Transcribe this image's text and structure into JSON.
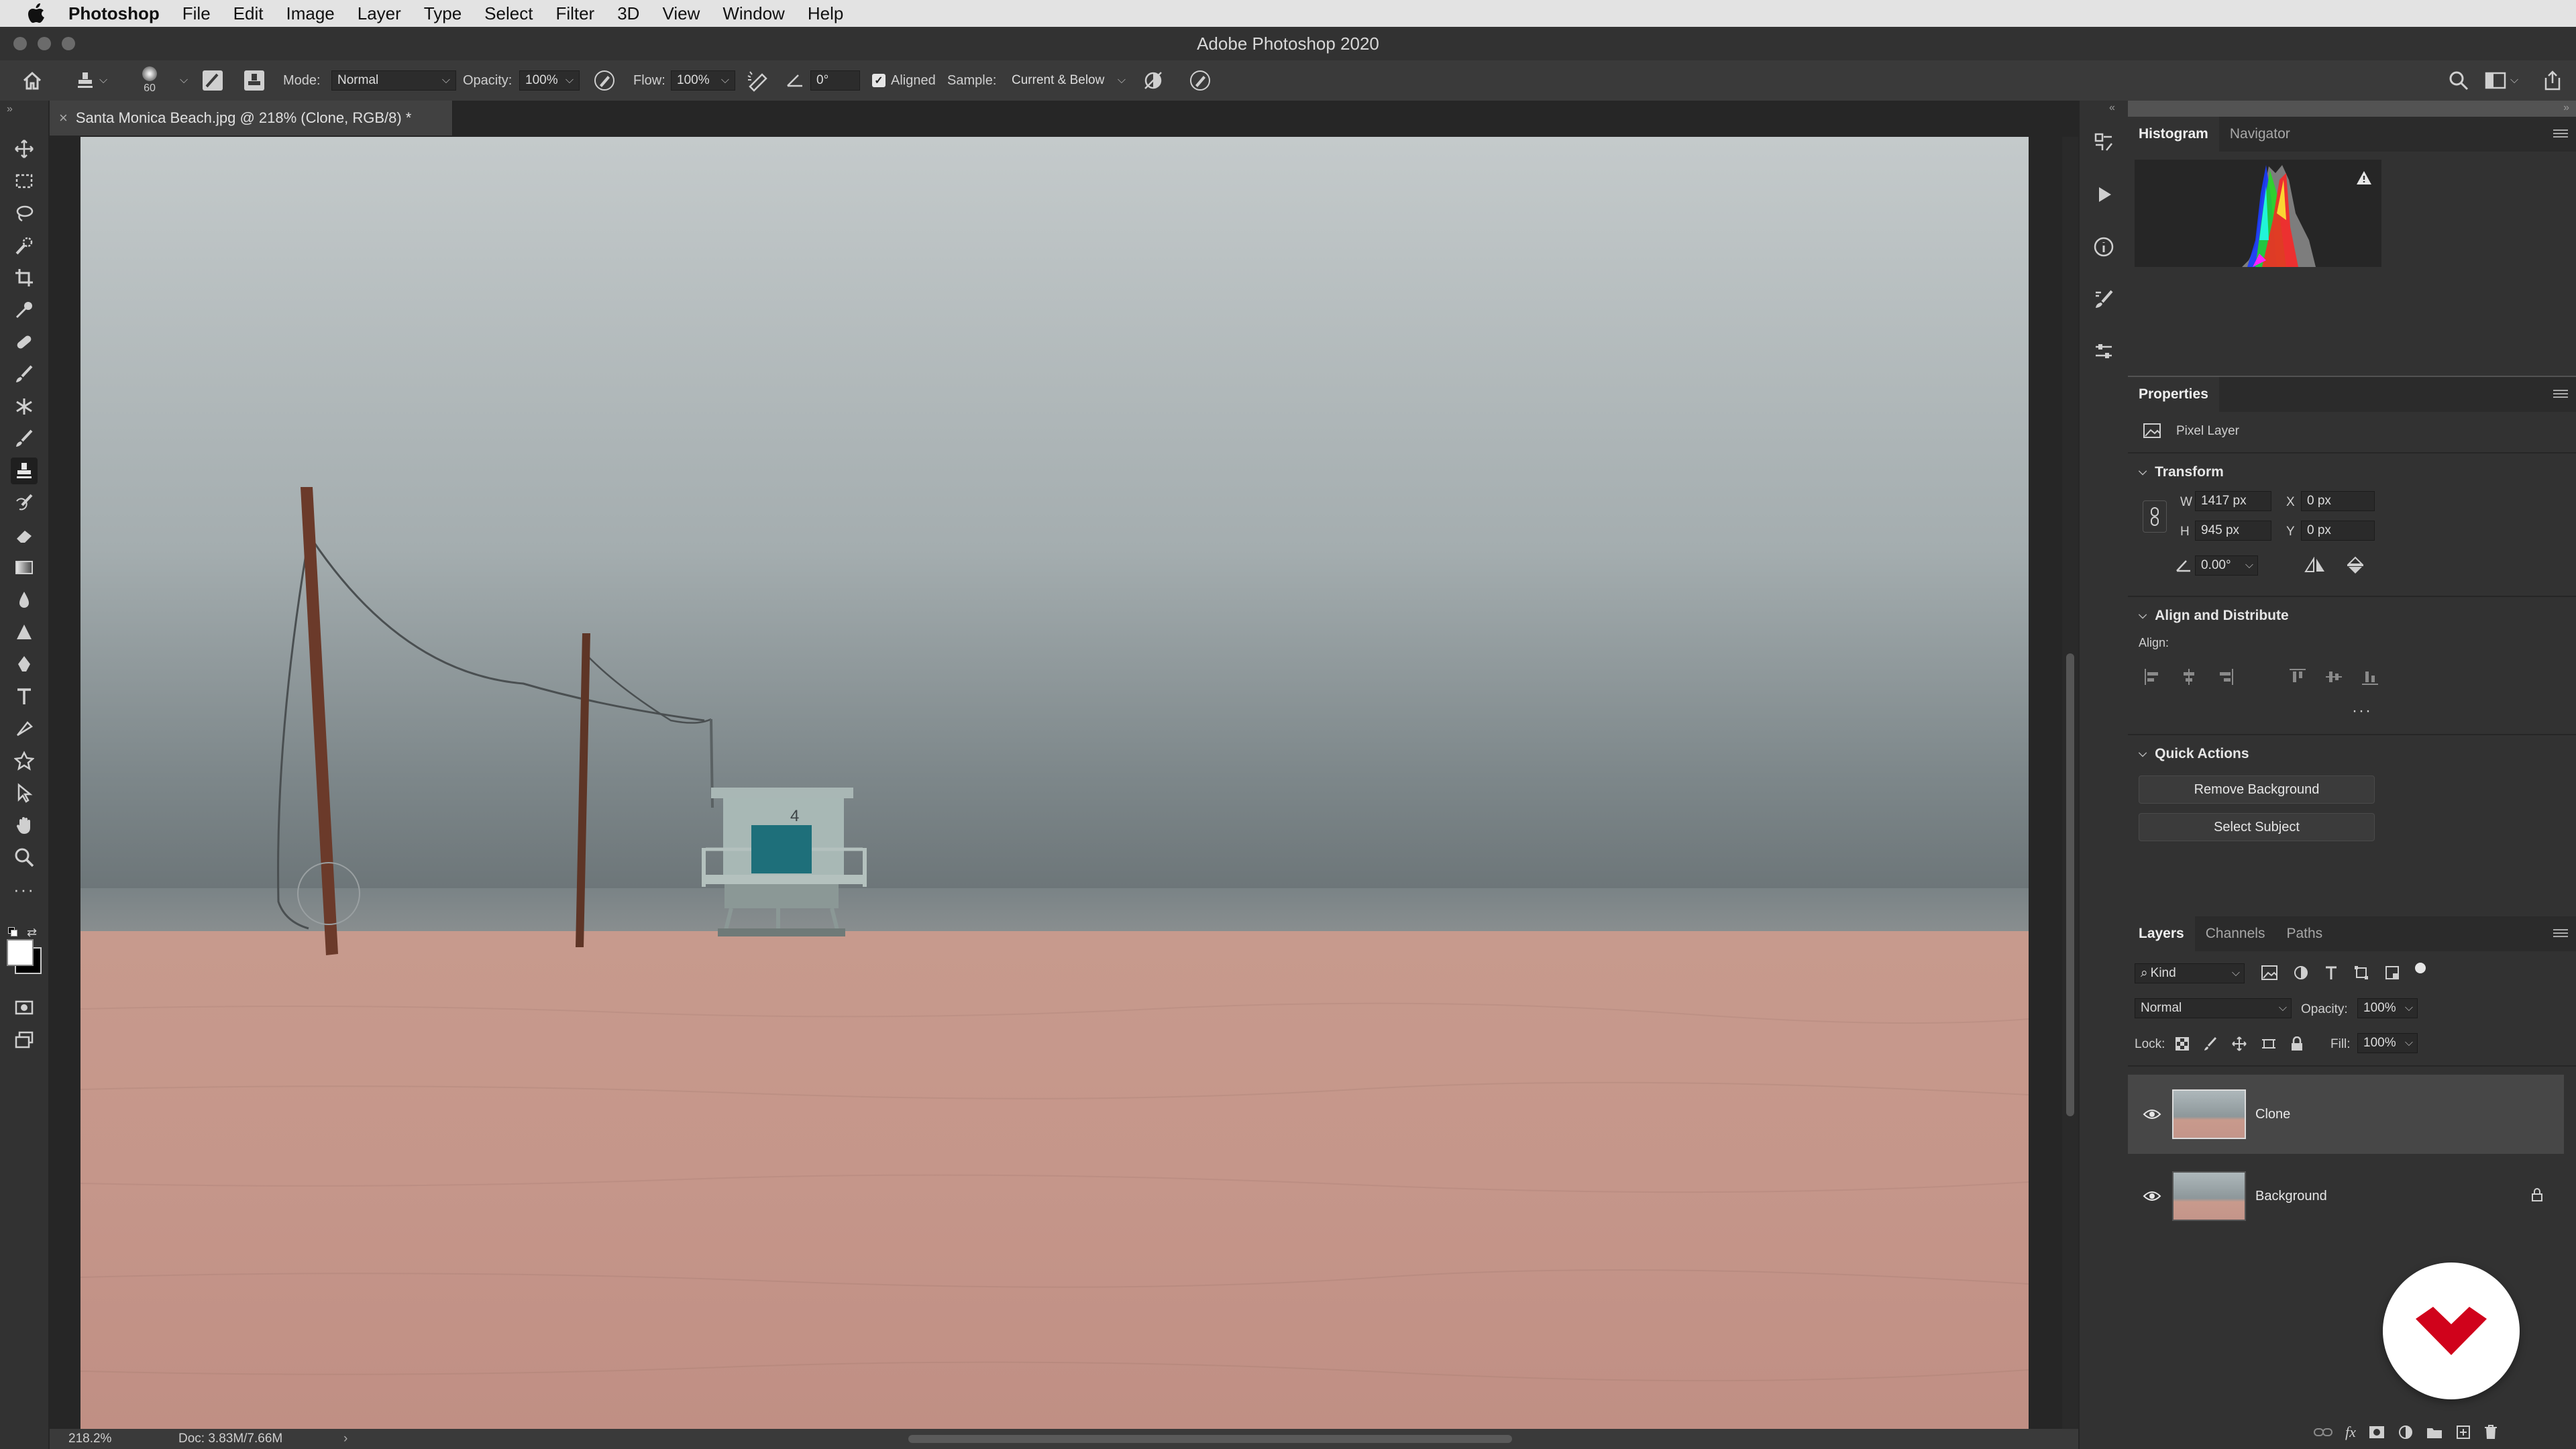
{
  "menubar": {
    "app_name": "Photoshop",
    "items": [
      "File",
      "Edit",
      "Image",
      "Layer",
      "Type",
      "Select",
      "Filter",
      "3D",
      "View",
      "Window",
      "Help"
    ]
  },
  "window": {
    "title": "Adobe Photoshop 2020"
  },
  "options_bar": {
    "brush_size": "60",
    "mode_label": "Mode:",
    "mode_value": "Normal",
    "opacity_label": "Opacity:",
    "opacity_value": "100%",
    "flow_label": "Flow:",
    "flow_value": "100%",
    "angle_value": "0°",
    "aligned_label": "Aligned",
    "aligned_checked": true,
    "sample_label": "Sample:",
    "sample_value": "Current & Below"
  },
  "document": {
    "tab_title": "Santa Monica Beach.jpg @ 218% (Clone, RGB/8) *",
    "tower_number": "4"
  },
  "status": {
    "zoom": "218.2%",
    "doc_info": "Doc: 3.83M/7.66M"
  },
  "histogram_panel": {
    "tabs": [
      "Histogram",
      "Navigator"
    ]
  },
  "properties_panel": {
    "tab": "Properties",
    "layer_type": "Pixel Layer",
    "transform": {
      "title": "Transform",
      "w_label": "W",
      "w_value": "1417 px",
      "h_label": "H",
      "h_value": "945 px",
      "x_label": "X",
      "x_value": "0 px",
      "y_label": "Y",
      "y_value": "0 px",
      "angle_value": "0.00°"
    },
    "align": {
      "title": "Align and Distribute",
      "align_label": "Align:"
    },
    "quick_actions": {
      "title": "Quick Actions",
      "remove_bg": "Remove Background",
      "select_subject": "Select Subject"
    }
  },
  "layers_panel": {
    "tabs": [
      "Layers",
      "Channels",
      "Paths"
    ],
    "filter_kind": "Kind",
    "blend_mode": "Normal",
    "opacity_label": "Opacity:",
    "opacity_value": "100%",
    "lock_label": "Lock:",
    "fill_label": "Fill:",
    "fill_value": "100%",
    "layers": [
      {
        "name": "Clone",
        "selected": true,
        "locked": false
      },
      {
        "name": "Background",
        "selected": false,
        "locked": true
      }
    ]
  },
  "colors": {
    "ui_dark": "#323232",
    "canvas_bg": "#262626",
    "sand": "#c79b8c",
    "sky": "#a9b3b5",
    "logo_red": "#d0021b"
  }
}
